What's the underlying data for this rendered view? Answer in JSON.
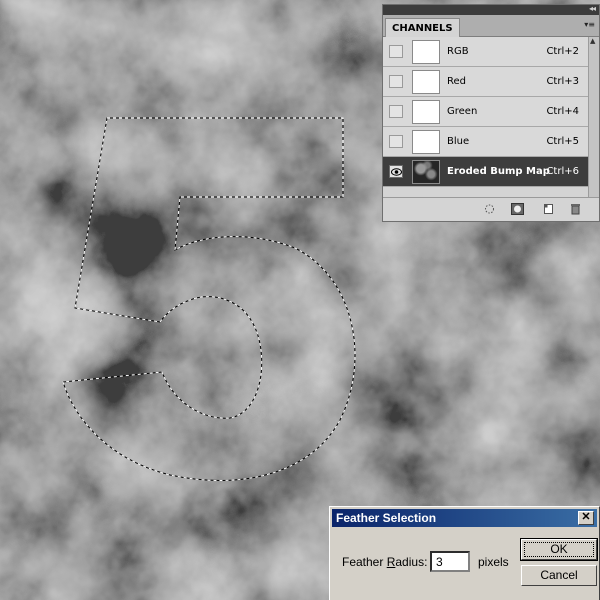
{
  "channels_panel": {
    "tab_label": "CHANNELS",
    "channels": [
      {
        "name": "RGB",
        "shortcut": "Ctrl+2",
        "visible": false,
        "selected": false,
        "thumb": "white"
      },
      {
        "name": "Red",
        "shortcut": "Ctrl+3",
        "visible": false,
        "selected": false,
        "thumb": "white"
      },
      {
        "name": "Green",
        "shortcut": "Ctrl+4",
        "visible": false,
        "selected": false,
        "thumb": "white"
      },
      {
        "name": "Blue",
        "shortcut": "Ctrl+5",
        "visible": false,
        "selected": false,
        "thumb": "white"
      },
      {
        "name": "Eroded Bump Map",
        "shortcut": "Ctrl+6",
        "visible": true,
        "selected": true,
        "thumb": "bump"
      }
    ],
    "footer_icons": [
      "load-selection-icon",
      "save-selection-icon",
      "new-channel-icon",
      "delete-channel-icon"
    ]
  },
  "feather_dialog": {
    "title": "Feather Selection",
    "radius_label_pre": "Feather ",
    "radius_label_mnemonic": "R",
    "radius_label_post": "adius:",
    "radius_value": "3",
    "unit": "pixels",
    "ok_label": "OK",
    "cancel_label": "Cancel"
  },
  "colors": {
    "selected_row": "#3d3d3d",
    "titlebar": "#0a246a"
  }
}
